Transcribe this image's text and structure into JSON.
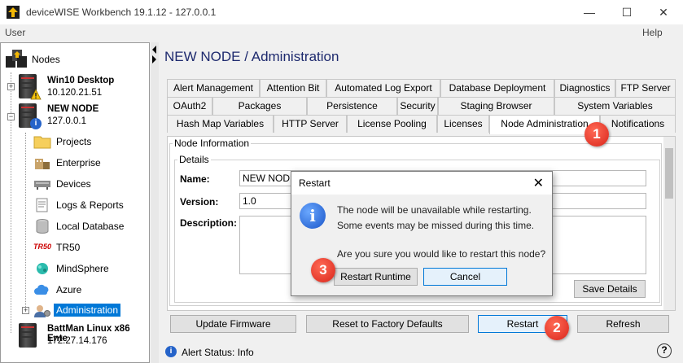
{
  "window": {
    "title": "deviceWISE Workbench 19.1.12  -  127.0.0.1",
    "minimize_glyph": "—",
    "maximize_glyph": "☐",
    "close_glyph": "✕"
  },
  "menu": {
    "left": "User",
    "right": "Help"
  },
  "tree": {
    "root_label": "Nodes",
    "nodes": [
      {
        "name": "Win10 Desktop",
        "ip": "10.120.21.51",
        "badge": "warning"
      },
      {
        "name": "NEW NODE",
        "ip": "127.0.0.1",
        "badge": "info"
      },
      {
        "name": "BattMan Linux x86 Ente",
        "ip": "172.27.14.176"
      }
    ],
    "children": [
      {
        "label": "Projects",
        "icon": "folder-icon"
      },
      {
        "label": "Enterprise",
        "icon": "enterprise-icon"
      },
      {
        "label": "Devices",
        "icon": "devices-icon"
      },
      {
        "label": "Logs & Reports",
        "icon": "logs-icon"
      },
      {
        "label": "Local Database",
        "icon": "database-icon"
      },
      {
        "label": "TR50",
        "icon": "tr50-logo"
      },
      {
        "label": "MindSphere",
        "icon": "mindsphere-icon"
      },
      {
        "label": "Azure",
        "icon": "azure-icon"
      },
      {
        "label": "Administration",
        "icon": "administration-icon",
        "selected": true
      }
    ],
    "tr50_logo_text": "TR50"
  },
  "main": {
    "heading": "NEW NODE / Administration",
    "tabs_row1": [
      "Alert Management",
      "Attention Bit",
      "Automated Log Export",
      "Database Deployment",
      "Diagnostics",
      "FTP Server"
    ],
    "tabs_row2": [
      "OAuth2",
      "Packages",
      "Persistence",
      "Security",
      "Staging Browser",
      "System Variables"
    ],
    "tabs_row3": [
      "Hash Map Variables",
      "HTTP Server",
      "License Pooling",
      "Licenses",
      "Node Administration",
      "Notifications"
    ],
    "active_tab": "Node Administration",
    "node_info": {
      "legend": "Node Information",
      "details_legend": "Details",
      "name_label": "Name:",
      "name_value": "NEW NODE",
      "version_label": "Version:",
      "version_value": "1.0",
      "description_label": "Description:",
      "description_value": "",
      "save_button": "Save Details"
    },
    "buttons": {
      "update_firmware": "Update Firmware",
      "reset_factory": "Reset to Factory Defaults",
      "restart": "Restart",
      "refresh": "Refresh"
    },
    "status": {
      "text": "Alert Status: Info",
      "help_glyph": "?"
    }
  },
  "dialog": {
    "title": "Restart",
    "line1": "The node will be unavailable while restarting.",
    "line2": "Some events may be missed during this time.",
    "line3": "Are you sure you would like to restart this node?",
    "restart_runtime": "Restart Runtime",
    "cancel": "Cancel",
    "close_glyph": "✕"
  },
  "callouts": [
    "1",
    "2",
    "3"
  ],
  "colors": {
    "heading": "#1e2a6e",
    "selection": "#0078d7",
    "callout": "#d9251b"
  }
}
